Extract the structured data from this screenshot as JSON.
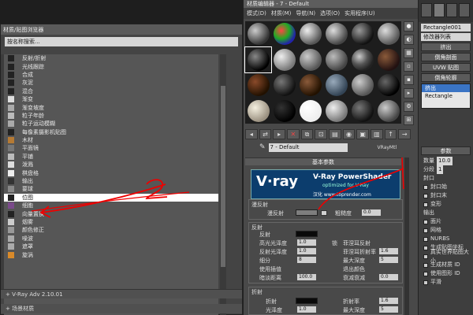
{
  "browser": {
    "title": "材质/贴图浏览器",
    "search_placeholder": "按名称搜索...",
    "items": [
      {
        "label": "反射/折射",
        "color": "#222"
      },
      {
        "label": "光线跟踪",
        "color": "#222"
      },
      {
        "label": "合成",
        "color": "#222"
      },
      {
        "label": "灰泥",
        "color": "#222"
      },
      {
        "label": "混合",
        "color": "#222"
      },
      {
        "label": "渐变",
        "color": "#ddd"
      },
      {
        "label": "渐变坡度",
        "color": "#aaa"
      },
      {
        "label": "粒子年龄",
        "color": "#bbb"
      },
      {
        "label": "粒子运动模糊",
        "color": "#aaa"
      },
      {
        "label": "每像素摄影机贴图",
        "color": "#222"
      },
      {
        "label": "木材",
        "color": "#b57a34"
      },
      {
        "label": "平面镜",
        "color": "#777"
      },
      {
        "label": "平铺",
        "color": "#bbb"
      },
      {
        "label": "泼溅",
        "color": "#ddd"
      },
      {
        "label": "棋盘格",
        "color": "#eee"
      },
      {
        "label": "输出",
        "color": "#333"
      },
      {
        "label": "要球",
        "color": "#888"
      },
      {
        "label": "位图",
        "color": "#222"
      },
      {
        "label": "细胞",
        "color": "#7a4a8a"
      },
      {
        "label": "向量置换",
        "color": "#222"
      },
      {
        "label": "烟雾",
        "color": "#ccc"
      },
      {
        "label": "颜色修正",
        "color": "#999"
      },
      {
        "label": "噪波",
        "color": "#aaa"
      },
      {
        "label": "遮罩",
        "color": "#aaa"
      },
      {
        "label": "旋涡",
        "color": "#d98a2a"
      }
    ],
    "selected_index": 17,
    "group1": "+ V-Ray Adv 2.10.01",
    "group2": "+ 场景材质"
  },
  "editor": {
    "title": "材质编辑器 - 7 - Default",
    "menu": [
      "模式(D)",
      "材质(M)",
      "导航(N)",
      "选项(O)",
      "实用程序(U)"
    ],
    "material_name": "7 - Default",
    "material_type": "VRayMtl",
    "rollout_basic": "基本参数",
    "banner_logo": "V·ray",
    "banner_title": "V-Ray PowerShader",
    "banner_sub": "optimized for V-Ray",
    "banner_credit": "汉化 www.toprender.com",
    "diffuse_group": "漫反射",
    "diffuse_label": "漫反射",
    "roughness_label": "粗糙度",
    "roughness_value": "0.0",
    "reflection_group": "反射",
    "refl_labels": [
      "反射",
      "高光光泽度",
      "反射光泽度",
      "细分",
      "使用插值",
      "暗淡距离"
    ],
    "refl_values": [
      "",
      "1.0",
      "1.0",
      "8",
      "",
      "100.0"
    ],
    "refl_right_labels": [
      "菲涅耳反射",
      "菲涅耳折射率",
      "最大深度",
      "退出颜色",
      "衰减衰减"
    ],
    "refl_right_values": [
      "",
      "1.6",
      "5",
      "",
      "0.0"
    ],
    "lock_label": "锁",
    "refraction_group": "折射",
    "refr_labels": [
      "折射",
      "光泽度"
    ],
    "refr_values": [
      "",
      "1.0"
    ],
    "refr_right_labels": [
      "折射率",
      "最大深度"
    ],
    "refr_right_values": [
      "1.6",
      "5"
    ]
  },
  "right": {
    "object_name": "Rectangle001",
    "modifier_list": "修改器列表",
    "btns": [
      "挤出",
      "倒角剖面",
      "UVW 贴图",
      "倒角轮廓"
    ],
    "stack": [
      "挤出",
      "Rectangle"
    ],
    "params": "参数",
    "amount_label": "数量",
    "amount_value": "10.0",
    "segments_label": "分段",
    "segments_value": "1",
    "cap_label": "封口",
    "cap_start": "封口始",
    "cap_end": "封口末",
    "morph": "变形",
    "output": "输出",
    "output_opts": [
      "面片",
      "网格",
      "NURBS"
    ],
    "gen_coords": "生成贴图坐标",
    "real_world": "真实世界贴图大小",
    "gen_mat_id": "生成材质 ID",
    "use_shape_id": "使用图形 ID",
    "smooth": "平滑"
  }
}
